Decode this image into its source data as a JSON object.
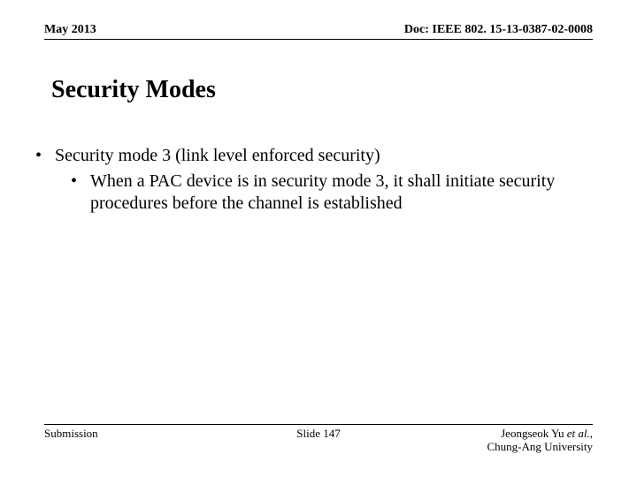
{
  "header": {
    "date": "May 2013",
    "doc": "Doc: IEEE 802. 15-13-0387-02-0008"
  },
  "title": "Security Modes",
  "bullets": {
    "l1": "Security mode 3 (link level enforced security)",
    "l2": "When a PAC device is in security mode 3, it shall initiate security procedures before the channel is established"
  },
  "footer": {
    "left": "Submission",
    "center": "Slide 147",
    "author_name": "Jeongseok Yu",
    "author_etal": " et al.",
    "author_comma": ",",
    "affiliation": "Chung-Ang University"
  }
}
